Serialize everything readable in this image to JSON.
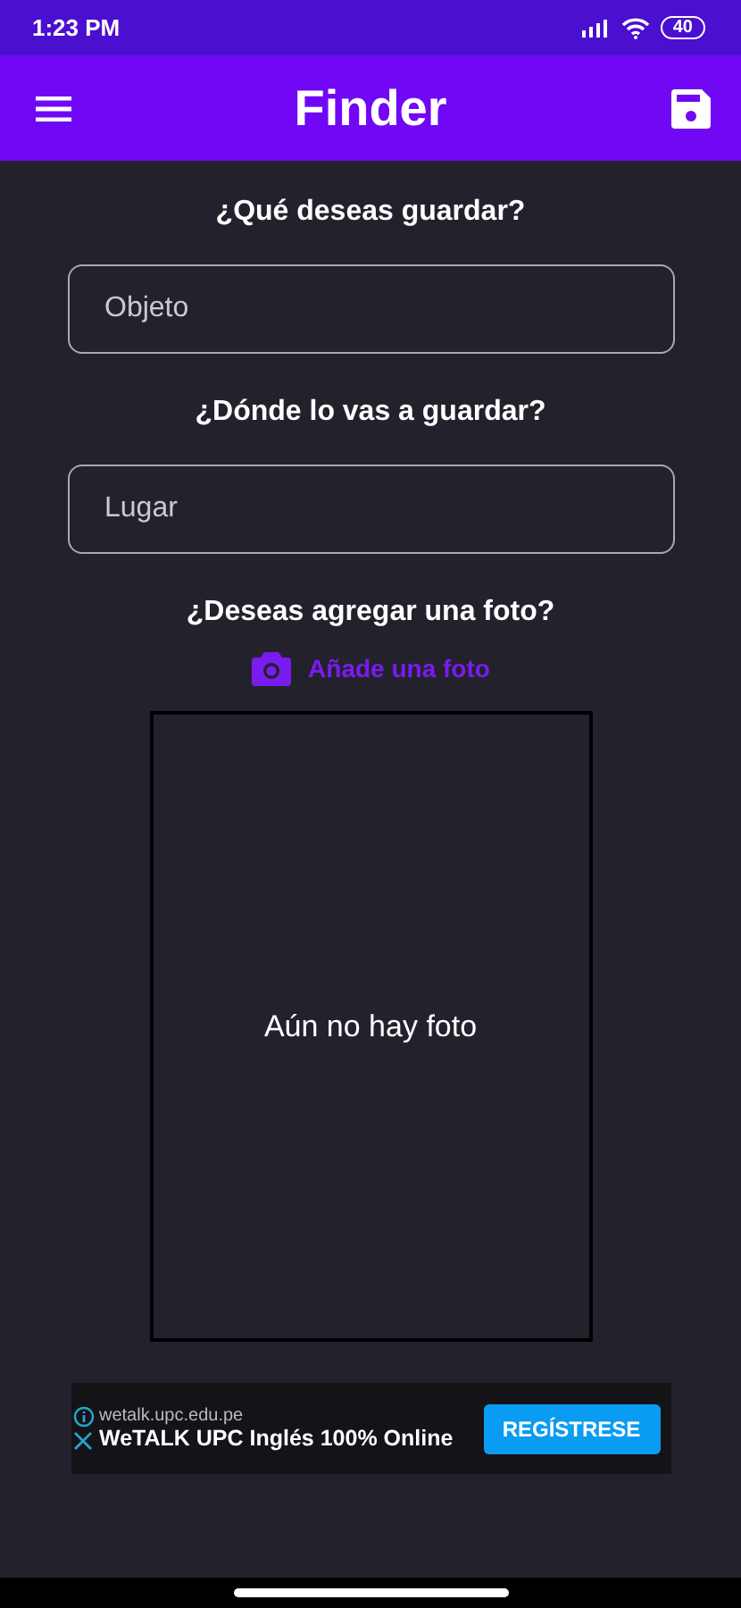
{
  "status_bar": {
    "time": "1:23 PM",
    "battery": "40"
  },
  "app_bar": {
    "title": "Finder"
  },
  "form": [
    {
      "question": "¿Qué deseas guardar?",
      "placeholder": "Objeto"
    },
    {
      "question": "¿Dónde lo vas a guardar?",
      "placeholder": "Lugar"
    }
  ],
  "photo": {
    "question": "¿Deseas agregar una foto?",
    "add_label": "Añade una foto",
    "empty_text": "Aún no hay foto"
  },
  "ad": {
    "domain": "wetalk.upc.edu.pe",
    "headline": "WeTALK UPC Inglés 100% Online",
    "button": "REGÍSTRESE"
  }
}
